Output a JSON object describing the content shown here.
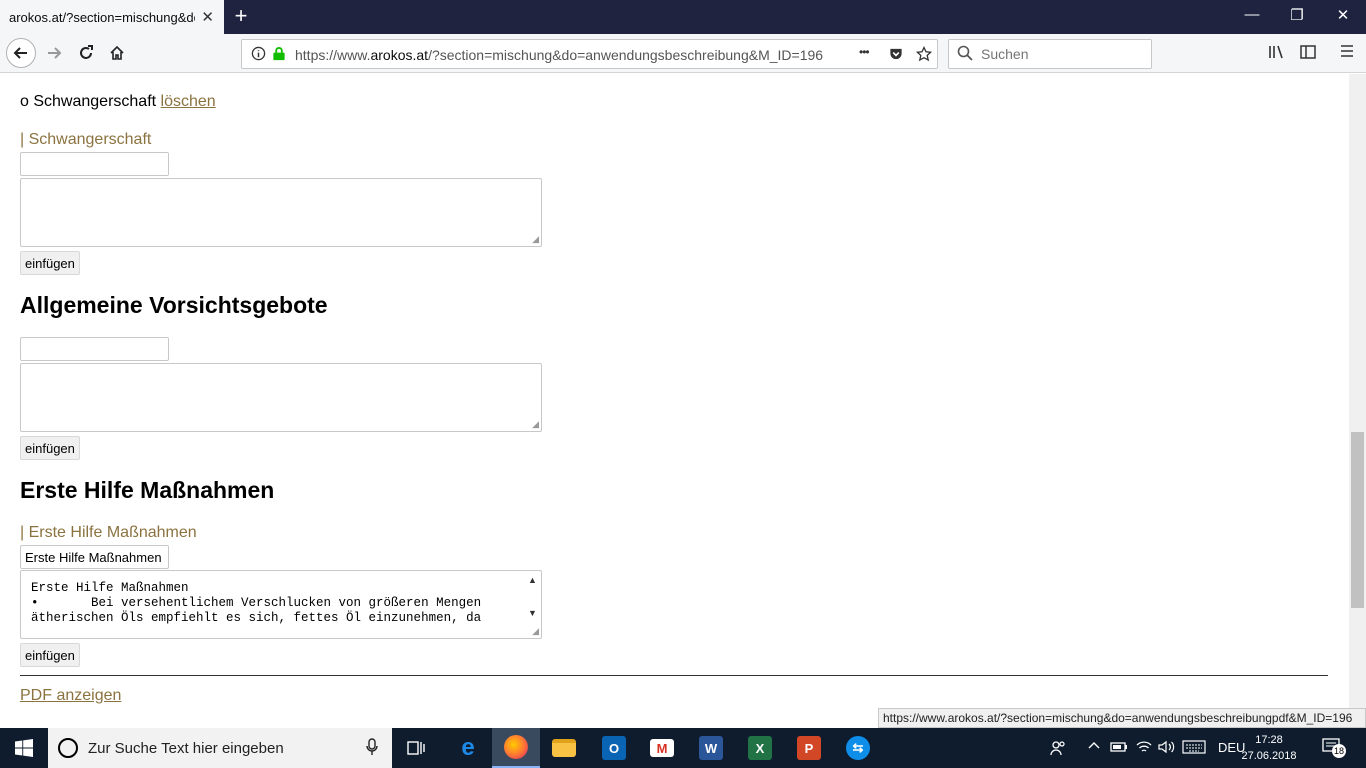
{
  "browser": {
    "tab_title": "arokos.at/?section=mischung&do=",
    "tab_close": "✕",
    "new_tab": "+",
    "window_controls": {
      "minimize": "—",
      "restore": "❐",
      "close": "✕"
    },
    "url_prefix": "https://www.",
    "url_domain": "arokos.at",
    "url_rest": "/?section=mischung&do=anwendungsbeschreibung&M_ID=196",
    "url_more": "•••",
    "search_placeholder": "Suchen",
    "icons": {
      "back": "back-arrow-icon",
      "forward": "forward-arrow-icon",
      "reload": "reload-icon",
      "home": "home-icon",
      "info": "info-icon",
      "lock": "lock-icon",
      "pocket": "pocket-icon",
      "bookmark": "star-icon",
      "library": "library-icon",
      "sidebar": "sidebar-icon",
      "menu": "hamburger-menu-icon"
    }
  },
  "page": {
    "item_prefix": "o Schwangerschaft",
    "delete_link": "löschen",
    "section1": {
      "label": "| Schwangerschaft",
      "input_value": "",
      "textarea_value": "",
      "button": "einfügen"
    },
    "section2": {
      "heading": "Allgemeine Vorsichtsgebote",
      "input_value": "",
      "textarea_value": "",
      "button": "einfügen"
    },
    "section3": {
      "heading": "Erste Hilfe Maßnahmen",
      "label": "| Erste Hilfe Maßnahmen",
      "input_value": "Erste Hilfe Maßnahmen",
      "textarea_line1": "Erste Hilfe Maßnahmen",
      "textarea_line2": "•       Bei versehentlichem Verschlucken von größeren Mengen",
      "textarea_line3": "ätherischen Öls empfiehlt es sich, fettes Öl einzunehmen, da",
      "button": "einfügen"
    },
    "pdf_link": "PDF anzeigen"
  },
  "status_url": "https://www.arokos.at/?section=mischung&do=anwendungsbeschreibungpdf&M_ID=196",
  "taskbar": {
    "search_placeholder": "Zur Suche Text hier eingeben",
    "language": "DEU",
    "time": "17:28",
    "date": "27.06.2018",
    "notification_count": "18",
    "apps": [
      "task-view",
      "edge",
      "firefox",
      "file-explorer",
      "outlook",
      "gmail",
      "word",
      "excel",
      "powerpoint",
      "teamviewer"
    ]
  }
}
